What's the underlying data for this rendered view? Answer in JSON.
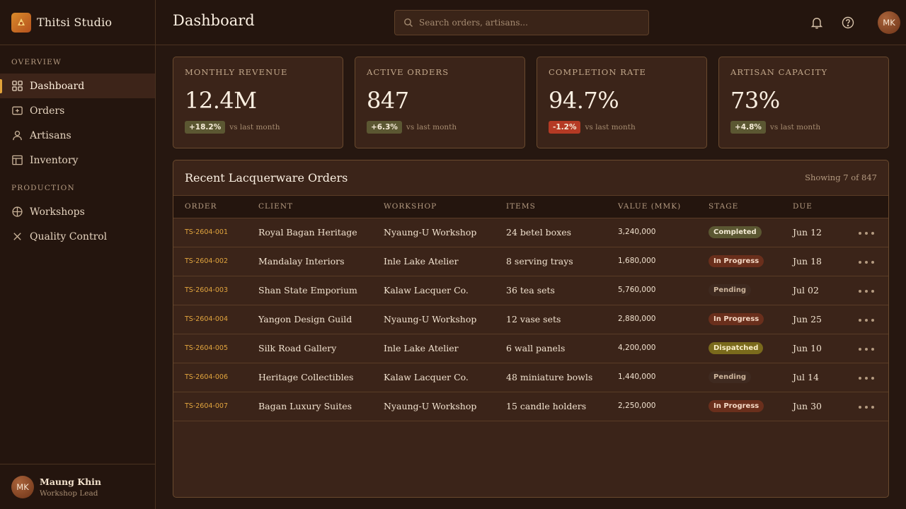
{
  "brand": {
    "name": "Thitsi Studio"
  },
  "sidebar": {
    "sections": [
      "OVERVIEW",
      "PRODUCTION"
    ],
    "overview_items": [
      {
        "label": "Dashboard",
        "icon": "grid-icon",
        "active": true
      },
      {
        "label": "Orders",
        "icon": "plus-box-icon"
      },
      {
        "label": "Artisans",
        "icon": "person-icon"
      },
      {
        "label": "Inventory",
        "icon": "layout-icon"
      }
    ],
    "production_items": [
      {
        "label": "Workshops",
        "icon": "crosshair-icon"
      },
      {
        "label": "Quality Control",
        "icon": "x-icon"
      }
    ]
  },
  "user": {
    "initials": "MK",
    "name": "Maung Khin",
    "role": "Workshop Lead"
  },
  "header": {
    "title": "Dashboard",
    "search_placeholder": "Search orders, artisans...",
    "avatar_initials": "MK"
  },
  "stats": [
    {
      "label": "MONTHLY REVENUE",
      "value": "12.4M",
      "delta": "+18.2%",
      "trend": "up",
      "note": "vs last month"
    },
    {
      "label": "ACTIVE ORDERS",
      "value": "847",
      "delta": "+6.3%",
      "trend": "up",
      "note": "vs last month"
    },
    {
      "label": "COMPLETION RATE",
      "value": "94.7%",
      "delta": "-1.2%",
      "trend": "down",
      "note": "vs last month"
    },
    {
      "label": "ARTISAN CAPACITY",
      "value": "73%",
      "delta": "+4.8%",
      "trend": "up",
      "note": "vs last month"
    }
  ],
  "orders": {
    "title": "Recent Lacquerware Orders",
    "count": "Showing 7 of 847",
    "columns": [
      "ORDER",
      "CLIENT",
      "WORKSHOP",
      "ITEMS",
      "VALUE (MMK)",
      "STAGE",
      "DUE"
    ],
    "rows": [
      {
        "id": "TS-2604-001",
        "client": "Royal Bagan Heritage",
        "workshop": "Nyaung-U Workshop",
        "items": "24 betel boxes",
        "value": "3,240,000",
        "stage": "Completed",
        "due": "Jun 12"
      },
      {
        "id": "TS-2604-002",
        "client": "Mandalay Interiors",
        "workshop": "Inle Lake Atelier",
        "items": "8 serving trays",
        "value": "1,680,000",
        "stage": "In Progress",
        "due": "Jun 18"
      },
      {
        "id": "TS-2604-003",
        "client": "Shan State Emporium",
        "workshop": "Kalaw Lacquer Co.",
        "items": "36 tea sets",
        "value": "5,760,000",
        "stage": "Pending",
        "due": "Jul 02"
      },
      {
        "id": "TS-2604-004",
        "client": "Yangon Design Guild",
        "workshop": "Nyaung-U Workshop",
        "items": "12 vase sets",
        "value": "2,880,000",
        "stage": "In Progress",
        "due": "Jun 25"
      },
      {
        "id": "TS-2604-005",
        "client": "Silk Road Gallery",
        "workshop": "Inle Lake Atelier",
        "items": "6 wall panels",
        "value": "4,200,000",
        "stage": "Dispatched",
        "due": "Jun 10"
      },
      {
        "id": "TS-2604-006",
        "client": "Heritage Collectibles",
        "workshop": "Kalaw Lacquer Co.",
        "items": "48 miniature bowls",
        "value": "1,440,000",
        "stage": "Pending",
        "due": "Jul 14"
      },
      {
        "id": "TS-2604-007",
        "client": "Bagan Luxury Suites",
        "workshop": "Nyaung-U Workshop",
        "items": "15 candle holders",
        "value": "2,250,000",
        "stage": "In Progress",
        "due": "Jun 30"
      }
    ]
  },
  "colors": {
    "accent": "#e2a33a",
    "background": "#261710",
    "card": "#3b2419",
    "positive": "#5b5732",
    "negative": "#b53a24"
  }
}
